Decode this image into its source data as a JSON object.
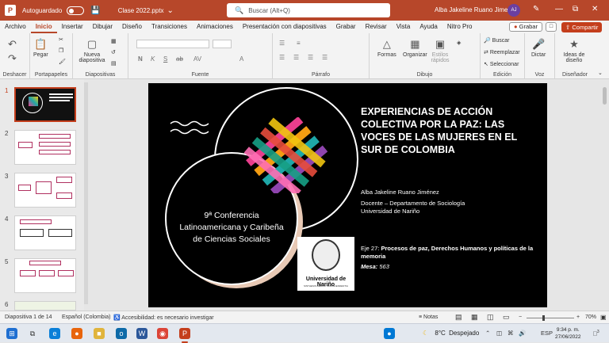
{
  "titlebar": {
    "autosave_label": "Autoguardado",
    "doc_title": "Clase 2022.pptx",
    "chevron": "⌄",
    "search_placeholder": "Buscar (Alt+Q)",
    "user_name": "Alba Jakeline Ruano Jimenez",
    "avatar_initials": "AJ"
  },
  "menu": {
    "tabs": [
      "Archivo",
      "Inicio",
      "Insertar",
      "Dibujar",
      "Diseño",
      "Transiciones",
      "Animaciones",
      "Presentación con diapositivas",
      "Grabar",
      "Revisar",
      "Vista",
      "Ayuda",
      "Nitro Pro"
    ],
    "active_tab": "Inicio",
    "grabar": "Grabar",
    "compartir": "Compartir"
  },
  "ribbon": {
    "groups": {
      "deshacer": "Deshacer",
      "portapapeles": "Portapapeles",
      "diapositivas": "Diapositivas",
      "fuente": "Fuente",
      "parrafo": "Párrafo",
      "dibujo": "Dibujo",
      "edicion": "Edición",
      "voz": "Voz",
      "disenador": "Diseñador"
    },
    "buttons": {
      "pegar": "Pegar",
      "nueva_diapositiva": "Nueva diapositiva",
      "formas": "Formas",
      "organizar": "Organizar",
      "estilos_rapidos": "Estilos rápidos",
      "buscar": "Buscar",
      "reemplazar": "Reemplazar",
      "seleccionar": "Seleccionar",
      "dictar": "Dictar",
      "ideas_diseno": "Ideas de diseño"
    },
    "format_letters": [
      "N",
      "K",
      "S",
      "ab",
      "AV"
    ]
  },
  "thumbnails": [
    {
      "num": "1"
    },
    {
      "num": "2"
    },
    {
      "num": "3"
    },
    {
      "num": "4"
    },
    {
      "num": "5"
    },
    {
      "num": "6"
    }
  ],
  "slide": {
    "conference": "9ª Conferencia Latinoamericana y Caribeña de Ciencias Sociales",
    "title": "EXPERIENCIAS DE ACCIÓN COLECTIVA POR LA PAZ: LAS VOCES DE LAS MUJERES EN EL SUR DE COLOMBIA",
    "author": "Alba Jakeline Ruano Jiménez",
    "role": "Docente – Departamento de Sociología",
    "institution": "Universidad de Nariño",
    "eje_label": "Eje 27:",
    "eje_text": "Procesos de paz, Derechos Humanos y políticas de la memoria",
    "mesa_label": "Mesa:",
    "mesa_value": "563",
    "logo_text": "Universidad de Nariño",
    "logo_subtext": "SINTHESIS RERUM TRANSCENDENTIA"
  },
  "statusbar": {
    "slide_info": "Diapositiva 1 de 14",
    "language": "Español (Colombia)",
    "accessibility": "Accesibilidad: es necesario investigar",
    "notas": "Notas",
    "zoom": "70%"
  },
  "taskbar": {
    "temperature": "8°C",
    "weather": "Despejado",
    "lang": "ESP",
    "time": "9:34 p. m.",
    "date": "27/06/2022",
    "notif_count": "3"
  },
  "colors": {
    "accent": "#b7472a",
    "share": "#c43e1c",
    "slide_bg": "#000000"
  }
}
